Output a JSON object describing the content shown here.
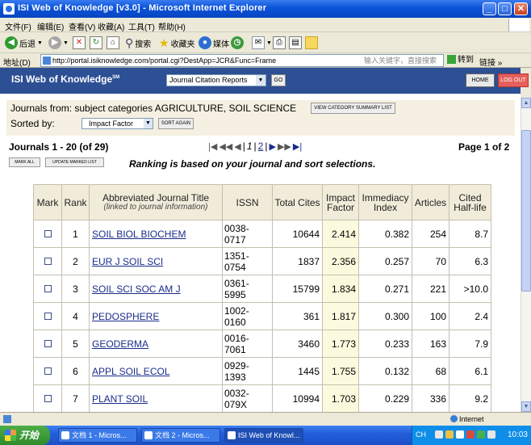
{
  "window": {
    "title": "ISI Web of Knowledge [v3.0] - Microsoft Internet Explorer",
    "controls": {
      "minimize": "_",
      "maximize": "□",
      "close": "✕"
    }
  },
  "menu": {
    "items": [
      "文件(F)",
      "编辑(E)",
      "查看(V)",
      "收藏(A)",
      "工具(T)",
      "帮助(H)"
    ]
  },
  "toolbar": {
    "back": "后退",
    "search": "搜索",
    "favorites": "收藏夹",
    "media": "媒体"
  },
  "addressbar": {
    "label": "地址(D)",
    "url": "http://portal.isiknowledge.com/portal.cgi?DestApp=JCR&Func=Frame",
    "hint": "输入关键字，直接搜索",
    "go": "转到",
    "links": "链接"
  },
  "header": {
    "logo": "ISI Web of Knowledge",
    "logo_sup": "SM",
    "database": "Journal Citation Reports",
    "go": "GO",
    "home": "HOME",
    "logout": "LOG OUT"
  },
  "criteria": {
    "journals_from_label": "Journals from:",
    "journals_from_value": "subject categories AGRICULTURE, SOIL SCIENCE",
    "view_summary": "VIEW CATEGORY SUMMARY LIST",
    "sorted_by_label": "Sorted by:",
    "sorted_by_value": "Impact Factor",
    "sort_again": "SORT AGAIN"
  },
  "results": {
    "count": "Journals 1 - 20 (of 29)",
    "page_of": "Page 1 of 2",
    "pager": {
      "current": "1",
      "next": "2",
      "sep": "|",
      "first": "|◀",
      "prev10": "◀◀",
      "prev": "◀",
      "nextarrow": "▶",
      "next10": "▶▶",
      "last": "▶|"
    },
    "mark_all": "MARK ALL",
    "update_marked": "UPDATE MARKED LIST",
    "ranking_note": "Ranking is based on your journal and sort selections.",
    "columns": {
      "mark": "Mark",
      "rank": "Rank",
      "title": "Abbreviated Journal Title",
      "title_sub": "(linked to journal information)",
      "issn": "ISSN",
      "total_cites": "Total Cites",
      "impact_factor": "Impact Factor",
      "immediacy": "Immediacy Index",
      "articles": "Articles",
      "half_life": "Cited Half-life"
    },
    "rows": [
      {
        "rank": "1",
        "title": "SOIL BIOL BIOCHEM",
        "issn1": "0038-",
        "issn2": "0717",
        "total": "10644",
        "impact": "2.414",
        "immediacy": "0.382",
        "articles": "254",
        "half_life": "8.7"
      },
      {
        "rank": "2",
        "title": "EUR J SOIL SCI",
        "issn1": "1351-",
        "issn2": "0754",
        "total": "1837",
        "impact": "2.356",
        "immediacy": "0.257",
        "articles": "70",
        "half_life": "6.3"
      },
      {
        "rank": "3",
        "title": "SOIL SCI SOC AM J",
        "issn1": "0361-",
        "issn2": "5995",
        "total": "15799",
        "impact": "1.834",
        "immediacy": "0.271",
        "articles": "221",
        "half_life": ">10.0"
      },
      {
        "rank": "4",
        "title": "PEDOSPHERE",
        "issn1": "1002-",
        "issn2": "0160",
        "total": "361",
        "impact": "1.817",
        "immediacy": "0.300",
        "articles": "100",
        "half_life": "2.4"
      },
      {
        "rank": "5",
        "title": "GEODERMA",
        "issn1": "0016-",
        "issn2": "7061",
        "total": "3460",
        "impact": "1.773",
        "immediacy": "0.233",
        "articles": "163",
        "half_life": "7.9"
      },
      {
        "rank": "6",
        "title": "APPL SOIL ECOL",
        "issn1": "0929-",
        "issn2": "1393",
        "total": "1445",
        "impact": "1.755",
        "immediacy": "0.132",
        "articles": "68",
        "half_life": "6.1"
      },
      {
        "rank": "7",
        "title": "PLANT SOIL",
        "issn1": "0032-",
        "issn2": "079X",
        "total": "10994",
        "impact": "1.703",
        "immediacy": "0.229",
        "articles": "336",
        "half_life": "9.2"
      }
    ]
  },
  "statusbar": {
    "zone": "Internet"
  },
  "taskbar": {
    "start": "开始",
    "tasks": [
      "文档 1 - Micros...",
      "文档 2 - Micros...",
      "ISI Web of Knowl..."
    ],
    "ime": "CH",
    "clock": "10:03"
  }
}
